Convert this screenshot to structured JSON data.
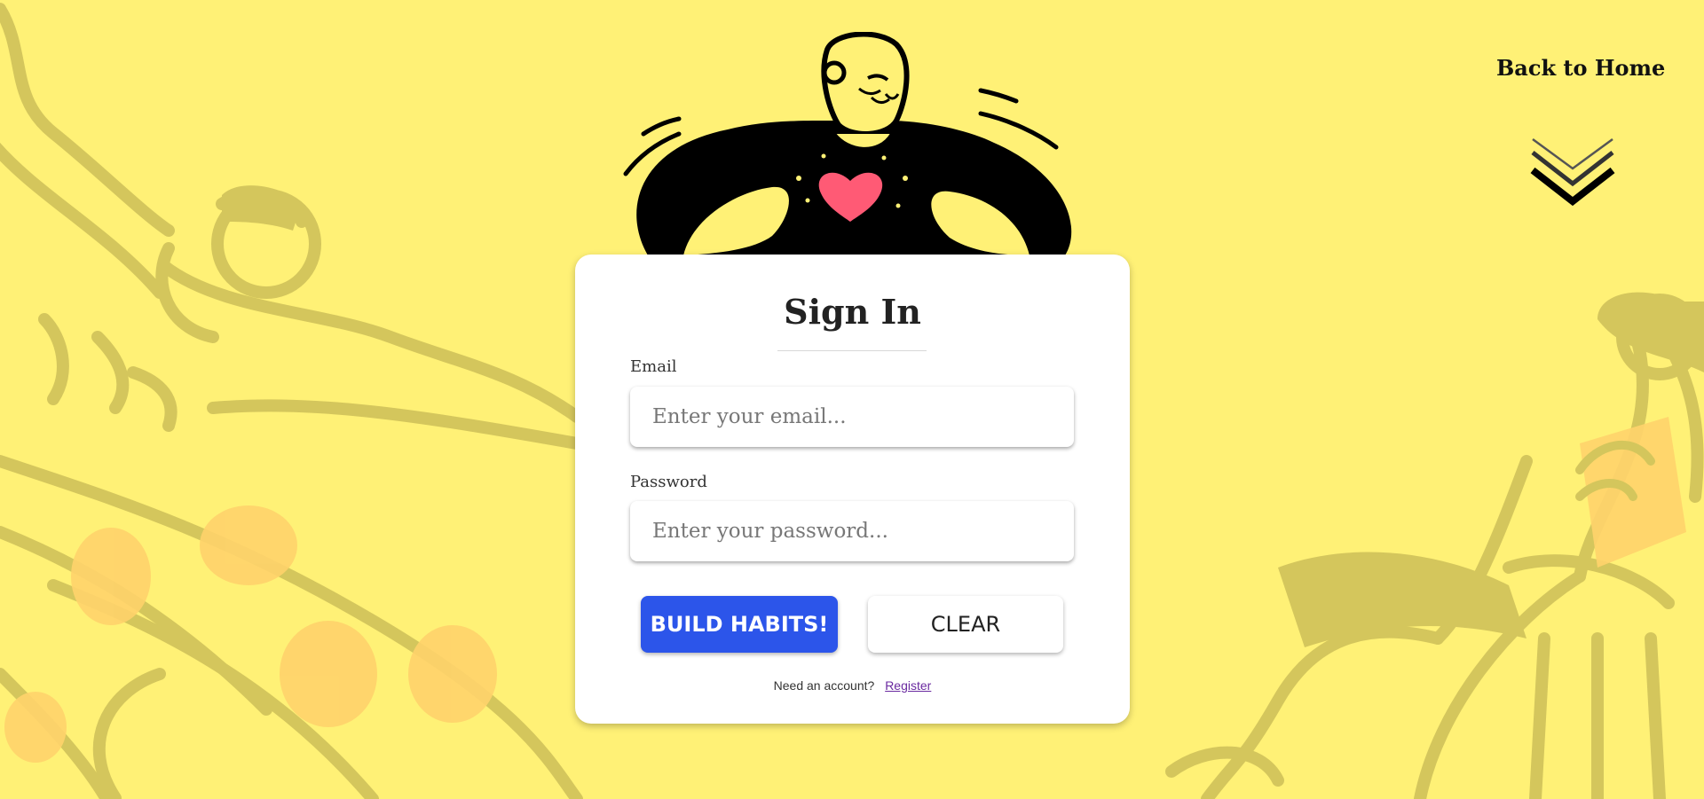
{
  "nav": {
    "back_home_label": "Back to Home",
    "scroll_icon": "double-chevron-down-icon"
  },
  "hero": {
    "illustration": "person-heart-illustration"
  },
  "form": {
    "title": "Sign In",
    "email": {
      "label": "Email",
      "placeholder": "Enter your email...",
      "value": ""
    },
    "password": {
      "label": "Password",
      "placeholder": "Enter your password...",
      "value": ""
    },
    "submit_label": "BUILD HABITS!",
    "clear_label": "CLEAR",
    "register_prompt": "Need an account?",
    "register_link": "Register"
  },
  "colors": {
    "background": "#fff176",
    "card": "#ffffff",
    "primary_button": "#2c55ea",
    "illustration_muted": "#d4c65c",
    "heart": "#ff5a75",
    "link": "#6a2aa0"
  }
}
